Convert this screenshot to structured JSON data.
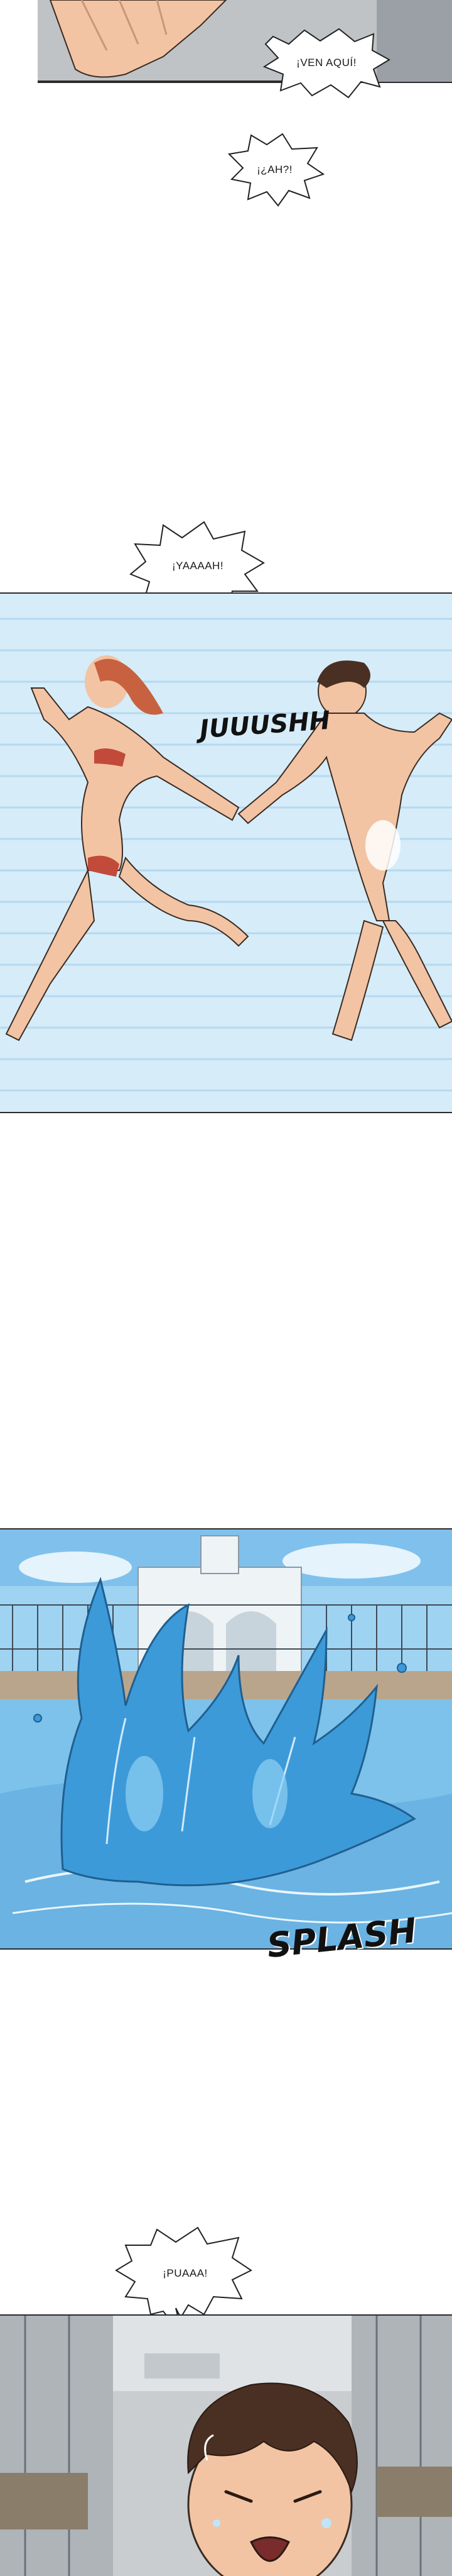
{
  "dialogue": {
    "ven_aqui": "¡VEN AQUÍ!",
    "eah": "¡¿AH?!",
    "yaaaah": "¡YAAAAH!",
    "puaaa": "¡PUAAA!"
  },
  "sfx": {
    "juuushh": "JUUUSHH",
    "splash": "SPLASH"
  },
  "colors": {
    "sky": "#9fd3f2",
    "water": "#6fb8e8",
    "speed_lines": "#cde7f7",
    "skin": "#f3c7a8",
    "hair_red": "#c8613f",
    "hair_brown": "#4a2f23"
  }
}
